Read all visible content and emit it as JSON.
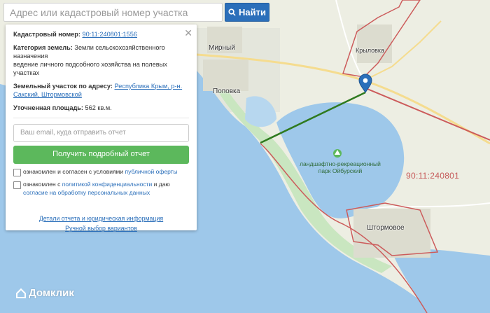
{
  "search": {
    "placeholder": "Адрес или кадастровый номер участка",
    "button_label": "Найти"
  },
  "panel": {
    "cadastral_label": "Кадастровый номер:",
    "cadastral_value": "90:11:240801:1556",
    "category_label": "Категория земель:",
    "category_value": "Земли сельскохозяйственного назначения",
    "category_value2": "ведение личного подсобного хозяйства на полевых участках",
    "address_label": "Земельный участок по адресу:",
    "address_value": "Республика Крым, р-н. Сакский, Штормовской",
    "area_label": "Уточненная площадь:",
    "area_value": "562 кв.м.",
    "email_placeholder": "Ваш email, куда отправить отчет",
    "get_report_label": "Получить подробный отчет",
    "consent1_text": "ознакомлен и согласен с условиями",
    "consent1_link": "публичной оферты",
    "consent2_text": "ознакомлен с",
    "consent2_link": "политикой конфиденциальности",
    "consent2_mid": "и даю",
    "consent2_link2": "согласие на обработку персональных данных",
    "details_link": "Детали отчета и юридическая информация",
    "manual_link": "Ручной выбор вариантов"
  },
  "map": {
    "places": {
      "mirny": "Мирный",
      "krylovka": "Крыловка",
      "popovka": "Поповка",
      "shtormovoe": "Штормовое"
    },
    "parcel_label": "90:11:240801",
    "park_label": "ландшафтно-рекреационный парк Ойбурский",
    "logo": "Домклик",
    "colors": {
      "sea": "#9ec8ea",
      "land": "#edeee3",
      "boundary": "#cc5b5b",
      "distance_line": "#2f7a1f",
      "marker": "#2b6fba"
    }
  }
}
